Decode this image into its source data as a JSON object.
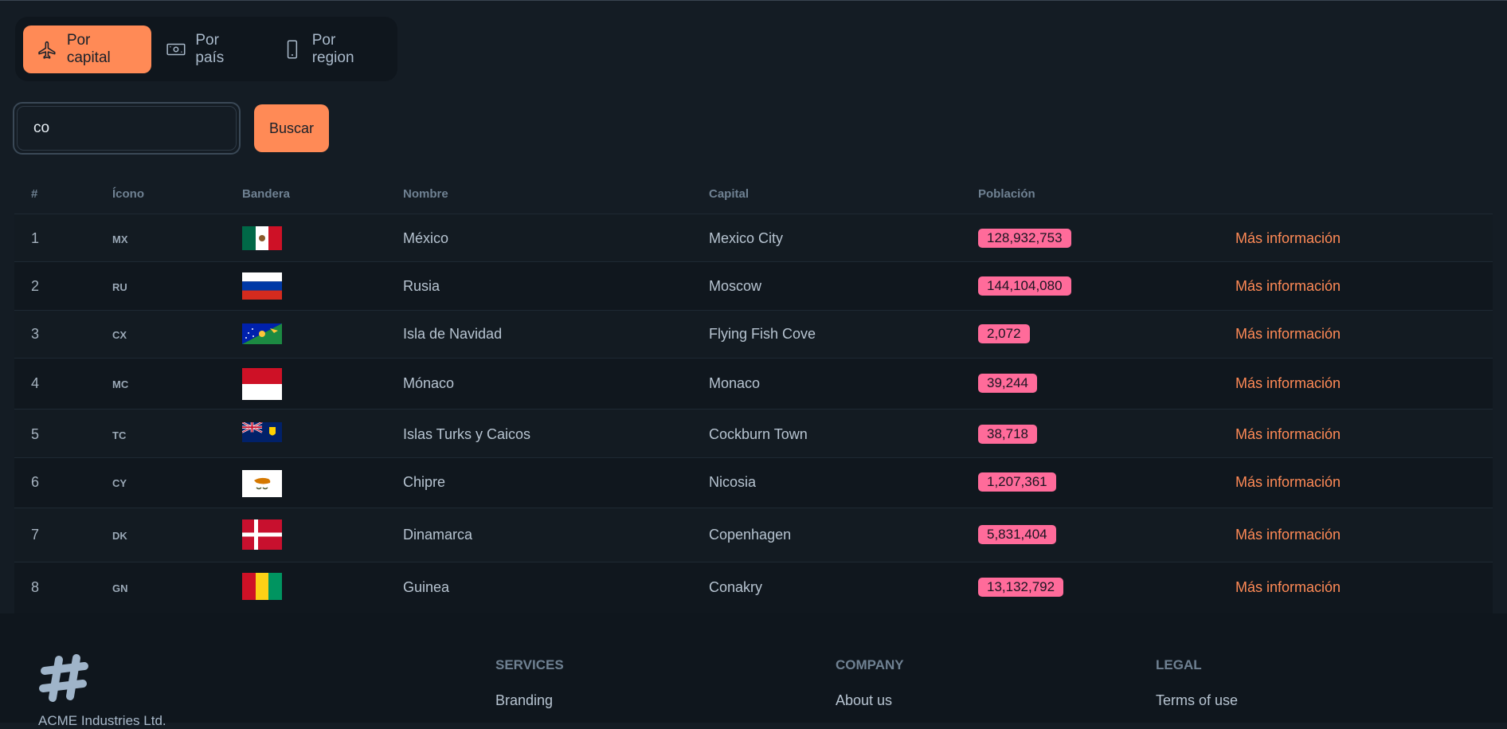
{
  "tabs": [
    {
      "label": "Por capital",
      "icon": "plane-icon",
      "active": true
    },
    {
      "label": "Por país",
      "icon": "banknote-icon",
      "active": false
    },
    {
      "label": "Por region",
      "icon": "phone-icon",
      "active": false
    }
  ],
  "search": {
    "value": "co",
    "button_label": "Buscar"
  },
  "table": {
    "headers": {
      "index": "#",
      "icon": "Ícono",
      "flag": "Bandera",
      "name": "Nombre",
      "capital": "Capital",
      "population": "Población"
    },
    "rows": [
      {
        "index": "1",
        "code": "MX",
        "name": "México",
        "capital": "Mexico City",
        "population": "128,932,753",
        "link": "Más información",
        "flag": "mexico-flag"
      },
      {
        "index": "2",
        "code": "RU",
        "name": "Rusia",
        "capital": "Moscow",
        "population": "144,104,080",
        "link": "Más información",
        "flag": "russia-flag"
      },
      {
        "index": "3",
        "code": "CX",
        "name": "Isla de Navidad",
        "capital": "Flying Fish Cove",
        "population": "2,072",
        "link": "Más información",
        "flag": "christmas-island-flag"
      },
      {
        "index": "4",
        "code": "MC",
        "name": "Mónaco",
        "capital": "Monaco",
        "population": "39,244",
        "link": "Más información",
        "flag": "monaco-flag"
      },
      {
        "index": "5",
        "code": "TC",
        "name": "Islas Turks y Caicos",
        "capital": "Cockburn Town",
        "population": "38,718",
        "link": "Más información",
        "flag": "turks-caicos-flag"
      },
      {
        "index": "6",
        "code": "CY",
        "name": "Chipre",
        "capital": "Nicosia",
        "population": "1,207,361",
        "link": "Más información",
        "flag": "cyprus-flag"
      },
      {
        "index": "7",
        "code": "DK",
        "name": "Dinamarca",
        "capital": "Copenhagen",
        "population": "5,831,404",
        "link": "Más información",
        "flag": "denmark-flag"
      },
      {
        "index": "8",
        "code": "GN",
        "name": "Guinea",
        "capital": "Conakry",
        "population": "13,132,792",
        "link": "Más información",
        "flag": "guinea-flag"
      }
    ]
  },
  "footer": {
    "company_name": "ACME Industries Ltd.",
    "columns": [
      {
        "title": "SERVICES",
        "first_link": "Branding"
      },
      {
        "title": "COMPANY",
        "first_link": "About us"
      },
      {
        "title": "LEGAL",
        "first_link": "Terms of use"
      }
    ]
  },
  "colors": {
    "accent": "#ff8a56",
    "badge": "#ff6b9a",
    "background": "#141c24"
  }
}
